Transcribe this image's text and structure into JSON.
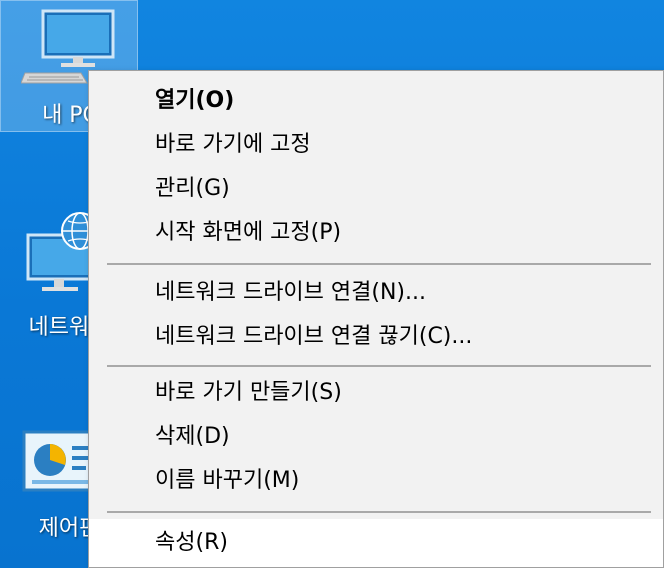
{
  "desktop": {
    "icons": [
      {
        "label": "내 PC",
        "icon": "computer-icon"
      },
      {
        "label": "네트워크",
        "icon": "network-icon"
      },
      {
        "label": "제어판",
        "icon": "control-panel-icon"
      }
    ]
  },
  "context_menu": {
    "items": [
      {
        "label": "열기(O)",
        "default": true
      },
      {
        "label": "바로 가기에 고정"
      },
      {
        "label": "관리(G)"
      },
      {
        "label": "시작 화면에 고정(P)"
      },
      {
        "label": "네트워크 드라이브 연결(N)..."
      },
      {
        "label": "네트워크 드라이브 연결 끊기(C)..."
      },
      {
        "label": "바로 가기 만들기(S)"
      },
      {
        "label": "삭제(D)"
      },
      {
        "label": "이름 바꾸기(M)"
      },
      {
        "label": "속성(R)",
        "highlighted": true
      }
    ]
  },
  "colors": {
    "desktop_background": "#0a78d6",
    "menu_background": "#f2f2f2",
    "menu_highlight": "#ffffff",
    "separator": "#a9a9a9"
  }
}
